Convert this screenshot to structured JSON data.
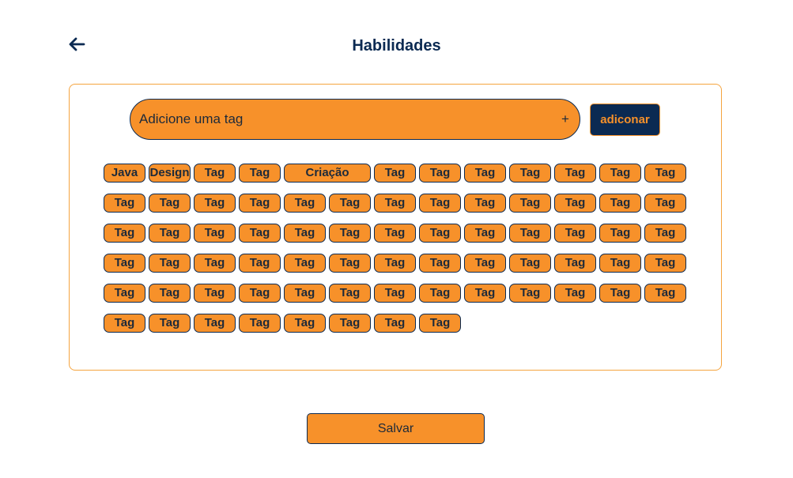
{
  "header": {
    "back_icon": "arrow-left-icon",
    "title": "Habilidades"
  },
  "tag_input": {
    "placeholder": "Adicione uma tag",
    "value": "",
    "plus_icon": "plus-icon",
    "plus_glyph": "+"
  },
  "add_button": {
    "label": "adiconar"
  },
  "tags": [
    [
      "Java",
      "Design",
      "Tag",
      "Tag",
      "Criação",
      "Tag",
      "Tag",
      "Tag",
      "Tag",
      "Tag",
      "Tag",
      "Tag"
    ],
    [
      "Tag",
      "Tag",
      "Tag",
      "Tag",
      "Tag",
      "Tag",
      "Tag",
      "Tag",
      "Tag",
      "Tag",
      "Tag",
      "Tag",
      "Tag"
    ],
    [
      "Tag",
      "Tag",
      "Tag",
      "Tag",
      "Tag",
      "Tag",
      "Tag",
      "Tag",
      "Tag",
      "Tag",
      "Tag",
      "Tag",
      "Tag"
    ],
    [
      "Tag",
      "Tag",
      "Tag",
      "Tag",
      "Tag",
      "Tag",
      "Tag",
      "Tag",
      "Tag",
      "Tag",
      "Tag",
      "Tag",
      "Tag"
    ],
    [
      "Tag",
      "Tag",
      "Tag",
      "Tag",
      "Tag",
      "Tag",
      "Tag",
      "Tag",
      "Tag",
      "Tag",
      "Tag",
      "Tag",
      "Tag"
    ],
    [
      "Tag",
      "Tag",
      "Tag",
      "Tag",
      "Tag",
      "Tag",
      "Tag",
      "Tag"
    ]
  ],
  "save_button": {
    "label": "Salvar"
  },
  "colors": {
    "primary_navy": "#0b2a52",
    "accent_orange": "#f7912a",
    "panel_border": "#f5a43f",
    "text_dark": "#1d2a3a"
  }
}
